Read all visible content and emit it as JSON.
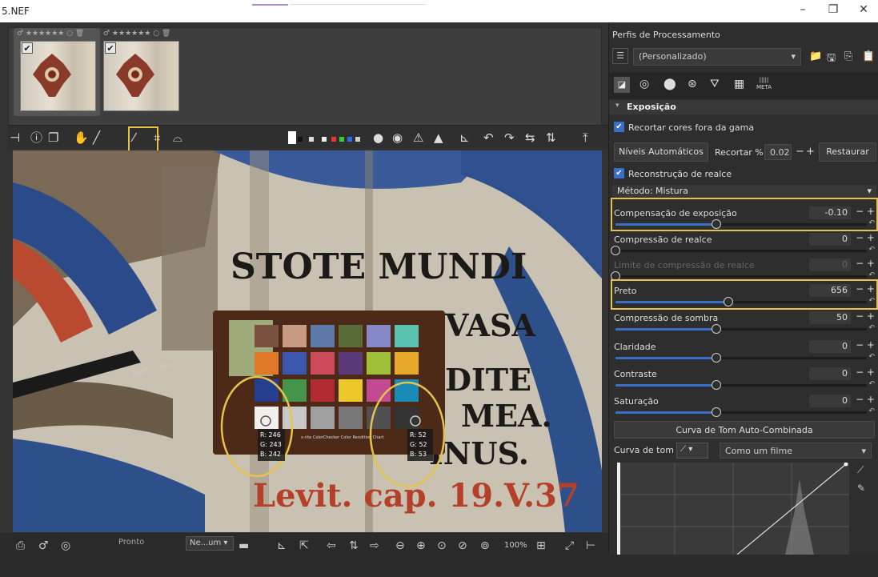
{
  "window": {
    "filename": "5.NEF",
    "min": "–",
    "restore": "❐",
    "close": "✕"
  },
  "thumbs": [
    {
      "stars": "♂ ★★★★★★ ○ 🗑"
    },
    {
      "stars": "♂ ★★★★★★ ○ 🗑"
    }
  ],
  "check": "✔",
  "picker_values": [
    {
      "r": "R: 246",
      "g": "G: 243",
      "b": "B: 242"
    },
    {
      "r": "R: 52",
      "g": "G: 52",
      "b": "B: 53"
    }
  ],
  "painting": {
    "line1": "STOTE MUNDI",
    "line2": "VASA",
    "line3": "DITE",
    "line4": "MEA.",
    "line5": "INUS.",
    "line6": "Levit. cap. 19.V.37",
    "brand": "Manfrotto",
    "chart_caption": "x-rite ColorChecker Color Rendition Chart"
  },
  "status": {
    "ready": "Pronto",
    "neum": "Ne...um ▾",
    "zoom": "100%"
  },
  "right": {
    "profiles_label": "Perfis de Processamento",
    "profile_value": "(Personalizado)",
    "meta_tab": "META",
    "section_title": "Exposição",
    "clip_label": "Recortar cores fora da gama",
    "auto_levels": "Níveis Automáticos",
    "clip_pct_label": "Recortar %",
    "clip_pct_value": "0.02",
    "minus": "−",
    "plus": "+",
    "reset": "Restaurar",
    "hl_recon_label": "Reconstrução de realce",
    "method_label": "Método:",
    "method_value": "Mistura",
    "sliders": [
      {
        "name": "Compensação de exposição",
        "value": "-0.10",
        "pos": 0.4
      },
      {
        "name": "Compressão de realce",
        "value": "0",
        "pos": 0.0
      },
      {
        "name": "Limite de compressão de realce",
        "value": "0",
        "pos": 0.0
      },
      {
        "name": "Preto",
        "value": "656",
        "pos": 0.45
      },
      {
        "name": "Compressão de sombra",
        "value": "50",
        "pos": 0.4
      },
      {
        "name": "Claridade",
        "value": "0",
        "pos": 0.4
      },
      {
        "name": "Contraste",
        "value": "0",
        "pos": 0.4
      },
      {
        "name": "Saturação",
        "value": "0",
        "pos": 0.4
      }
    ],
    "tonecurve_button": "Curva de Tom Auto-Combinada",
    "tonecurve_label": "Curva de tom 1:",
    "tonecurve_mode": "Como um filme"
  },
  "colors": {
    "accent": "#e6c34c",
    "slider": "#3a6fc8"
  }
}
